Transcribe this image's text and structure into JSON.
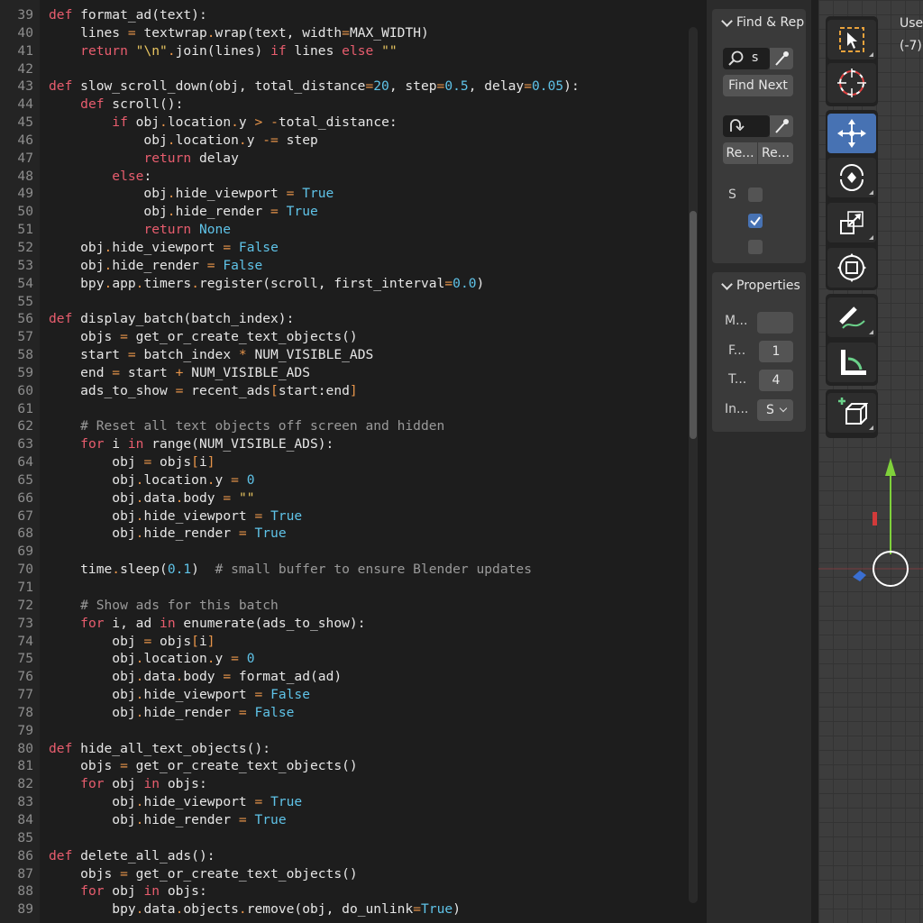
{
  "editor": {
    "first_line": 39,
    "lines": [
      [
        [
          "def",
          "k"
        ],
        [
          " format_ad(text):",
          ""
        ]
      ],
      [
        [
          "    lines ",
          ""
        ],
        [
          "=",
          "o"
        ],
        [
          " textwrap",
          ""
        ],
        [
          ".",
          "o"
        ],
        [
          "wrap(text, width",
          ""
        ],
        [
          "=",
          "o"
        ],
        [
          "MAX_WIDTH)",
          ""
        ]
      ],
      [
        [
          "    ",
          ""
        ],
        [
          "return",
          "k"
        ],
        [
          " ",
          ""
        ],
        [
          "\"\\n\"",
          "s"
        ],
        [
          ".",
          "o"
        ],
        [
          "join(lines) ",
          ""
        ],
        [
          "if",
          "k"
        ],
        [
          " lines ",
          ""
        ],
        [
          "else",
          "k"
        ],
        [
          " ",
          ""
        ],
        [
          "\"\"",
          "s"
        ]
      ],
      [],
      [
        [
          "def",
          "k"
        ],
        [
          " slow_scroll_down(obj, total_distance",
          ""
        ],
        [
          "=",
          "o"
        ],
        [
          "20",
          "n"
        ],
        [
          ", step",
          ""
        ],
        [
          "=",
          "o"
        ],
        [
          "0.5",
          "n"
        ],
        [
          ", delay",
          ""
        ],
        [
          "=",
          "o"
        ],
        [
          "0.05",
          "n"
        ],
        [
          "):",
          ""
        ]
      ],
      [
        [
          "    ",
          ""
        ],
        [
          "def",
          "k"
        ],
        [
          " scroll():",
          ""
        ]
      ],
      [
        [
          "        ",
          ""
        ],
        [
          "if",
          "k"
        ],
        [
          " obj",
          ""
        ],
        [
          ".",
          "o"
        ],
        [
          "location",
          ""
        ],
        [
          ".",
          "o"
        ],
        [
          "y ",
          ""
        ],
        [
          ">",
          "o"
        ],
        [
          " ",
          ""
        ],
        [
          "-",
          "o"
        ],
        [
          "total_distance:",
          ""
        ]
      ],
      [
        [
          "            obj",
          ""
        ],
        [
          ".",
          "o"
        ],
        [
          "location",
          ""
        ],
        [
          ".",
          "o"
        ],
        [
          "y ",
          ""
        ],
        [
          "-=",
          "o"
        ],
        [
          " step",
          ""
        ]
      ],
      [
        [
          "            ",
          ""
        ],
        [
          "return",
          "k"
        ],
        [
          " delay",
          ""
        ]
      ],
      [
        [
          "        ",
          ""
        ],
        [
          "else",
          "k"
        ],
        [
          ":",
          ""
        ]
      ],
      [
        [
          "            obj",
          ""
        ],
        [
          ".",
          "o"
        ],
        [
          "hide_viewport ",
          ""
        ],
        [
          "=",
          "o"
        ],
        [
          " ",
          ""
        ],
        [
          "True",
          "n"
        ]
      ],
      [
        [
          "            obj",
          ""
        ],
        [
          ".",
          "o"
        ],
        [
          "hide_render ",
          ""
        ],
        [
          "=",
          "o"
        ],
        [
          " ",
          ""
        ],
        [
          "True",
          "n"
        ]
      ],
      [
        [
          "            ",
          ""
        ],
        [
          "return",
          "k"
        ],
        [
          " ",
          ""
        ],
        [
          "None",
          "n"
        ]
      ],
      [
        [
          "    obj",
          ""
        ],
        [
          ".",
          "o"
        ],
        [
          "hide_viewport ",
          ""
        ],
        [
          "=",
          "o"
        ],
        [
          " ",
          ""
        ],
        [
          "False",
          "n"
        ]
      ],
      [
        [
          "    obj",
          ""
        ],
        [
          ".",
          "o"
        ],
        [
          "hide_render ",
          ""
        ],
        [
          "=",
          "o"
        ],
        [
          " ",
          ""
        ],
        [
          "False",
          "n"
        ]
      ],
      [
        [
          "    bpy",
          ""
        ],
        [
          ".",
          "o"
        ],
        [
          "app",
          ""
        ],
        [
          ".",
          "o"
        ],
        [
          "timers",
          ""
        ],
        [
          ".",
          "o"
        ],
        [
          "register(scroll, first_interval",
          ""
        ],
        [
          "=",
          "o"
        ],
        [
          "0.0",
          "n"
        ],
        [
          ")",
          ""
        ]
      ],
      [],
      [
        [
          "def",
          "k"
        ],
        [
          " display_batch(batch_index):",
          ""
        ]
      ],
      [
        [
          "    objs ",
          ""
        ],
        [
          "=",
          "o"
        ],
        [
          " get_or_create_text_objects()",
          ""
        ]
      ],
      [
        [
          "    start ",
          ""
        ],
        [
          "=",
          "o"
        ],
        [
          " batch_index ",
          ""
        ],
        [
          "*",
          "o"
        ],
        [
          " NUM_VISIBLE_ADS",
          ""
        ]
      ],
      [
        [
          "    end ",
          ""
        ],
        [
          "=",
          "o"
        ],
        [
          " start ",
          ""
        ],
        [
          "+",
          "o"
        ],
        [
          " NUM_VISIBLE_ADS",
          ""
        ]
      ],
      [
        [
          "    ads_to_show ",
          ""
        ],
        [
          "=",
          "o"
        ],
        [
          " recent_ads",
          ""
        ],
        [
          "[",
          "o"
        ],
        [
          "start:end",
          ""
        ],
        [
          "]",
          "o"
        ]
      ],
      [],
      [
        [
          "    ",
          ""
        ],
        [
          "# Reset all text objects off screen and hidden",
          "c"
        ]
      ],
      [
        [
          "    ",
          ""
        ],
        [
          "for",
          "k"
        ],
        [
          " i ",
          ""
        ],
        [
          "in",
          "k"
        ],
        [
          " range(NUM_VISIBLE_ADS):",
          ""
        ]
      ],
      [
        [
          "        obj ",
          ""
        ],
        [
          "=",
          "o"
        ],
        [
          " objs",
          ""
        ],
        [
          "[",
          "o"
        ],
        [
          "i",
          ""
        ],
        [
          "]",
          "o"
        ]
      ],
      [
        [
          "        obj",
          ""
        ],
        [
          ".",
          "o"
        ],
        [
          "location",
          ""
        ],
        [
          ".",
          "o"
        ],
        [
          "y ",
          ""
        ],
        [
          "=",
          "o"
        ],
        [
          " ",
          ""
        ],
        [
          "0",
          "n"
        ]
      ],
      [
        [
          "        obj",
          ""
        ],
        [
          ".",
          "o"
        ],
        [
          "data",
          ""
        ],
        [
          ".",
          "o"
        ],
        [
          "body ",
          ""
        ],
        [
          "=",
          "o"
        ],
        [
          " ",
          ""
        ],
        [
          "\"\"",
          "s"
        ]
      ],
      [
        [
          "        obj",
          ""
        ],
        [
          ".",
          "o"
        ],
        [
          "hide_viewport ",
          ""
        ],
        [
          "=",
          "o"
        ],
        [
          " ",
          ""
        ],
        [
          "True",
          "n"
        ]
      ],
      [
        [
          "        obj",
          ""
        ],
        [
          ".",
          "o"
        ],
        [
          "hide_render ",
          ""
        ],
        [
          "=",
          "o"
        ],
        [
          " ",
          ""
        ],
        [
          "True",
          "n"
        ]
      ],
      [],
      [
        [
          "    time",
          ""
        ],
        [
          ".",
          "o"
        ],
        [
          "sleep(",
          ""
        ],
        [
          "0.1",
          "n"
        ],
        [
          ")  ",
          ""
        ],
        [
          "# small buffer to ensure Blender updates",
          "c"
        ]
      ],
      [],
      [
        [
          "    ",
          ""
        ],
        [
          "# Show ads for this batch",
          "c"
        ]
      ],
      [
        [
          "    ",
          ""
        ],
        [
          "for",
          "k"
        ],
        [
          " i, ad ",
          ""
        ],
        [
          "in",
          "k"
        ],
        [
          " enumerate(ads_to_show):",
          ""
        ]
      ],
      [
        [
          "        obj ",
          ""
        ],
        [
          "=",
          "o"
        ],
        [
          " objs",
          ""
        ],
        [
          "[",
          "o"
        ],
        [
          "i",
          ""
        ],
        [
          "]",
          "o"
        ]
      ],
      [
        [
          "        obj",
          ""
        ],
        [
          ".",
          "o"
        ],
        [
          "location",
          ""
        ],
        [
          ".",
          "o"
        ],
        [
          "y ",
          ""
        ],
        [
          "=",
          "o"
        ],
        [
          " ",
          ""
        ],
        [
          "0",
          "n"
        ]
      ],
      [
        [
          "        obj",
          ""
        ],
        [
          ".",
          "o"
        ],
        [
          "data",
          ""
        ],
        [
          ".",
          "o"
        ],
        [
          "body ",
          ""
        ],
        [
          "=",
          "o"
        ],
        [
          " format_ad(ad)",
          ""
        ]
      ],
      [
        [
          "        obj",
          ""
        ],
        [
          ".",
          "o"
        ],
        [
          "hide_viewport ",
          ""
        ],
        [
          "=",
          "o"
        ],
        [
          " ",
          ""
        ],
        [
          "False",
          "n"
        ]
      ],
      [
        [
          "        obj",
          ""
        ],
        [
          ".",
          "o"
        ],
        [
          "hide_render ",
          ""
        ],
        [
          "=",
          "o"
        ],
        [
          " ",
          ""
        ],
        [
          "False",
          "n"
        ]
      ],
      [],
      [
        [
          "def",
          "k"
        ],
        [
          " hide_all_text_objects():",
          ""
        ]
      ],
      [
        [
          "    objs ",
          ""
        ],
        [
          "=",
          "o"
        ],
        [
          " get_or_create_text_objects()",
          ""
        ]
      ],
      [
        [
          "    ",
          ""
        ],
        [
          "for",
          "k"
        ],
        [
          " obj ",
          ""
        ],
        [
          "in",
          "k"
        ],
        [
          " objs:",
          ""
        ]
      ],
      [
        [
          "        obj",
          ""
        ],
        [
          ".",
          "o"
        ],
        [
          "hide_viewport ",
          ""
        ],
        [
          "=",
          "o"
        ],
        [
          " ",
          ""
        ],
        [
          "True",
          "n"
        ]
      ],
      [
        [
          "        obj",
          ""
        ],
        [
          ".",
          "o"
        ],
        [
          "hide_render ",
          ""
        ],
        [
          "=",
          "o"
        ],
        [
          " ",
          ""
        ],
        [
          "True",
          "n"
        ]
      ],
      [],
      [
        [
          "def",
          "k"
        ],
        [
          " delete_all_ads():",
          ""
        ]
      ],
      [
        [
          "    objs ",
          ""
        ],
        [
          "=",
          "o"
        ],
        [
          " get_or_create_text_objects()",
          ""
        ]
      ],
      [
        [
          "    ",
          ""
        ],
        [
          "for",
          "k"
        ],
        [
          " obj ",
          ""
        ],
        [
          "in",
          "k"
        ],
        [
          " objs:",
          ""
        ]
      ],
      [
        [
          "        bpy",
          ""
        ],
        [
          ".",
          "o"
        ],
        [
          "data",
          ""
        ],
        [
          ".",
          "o"
        ],
        [
          "objects",
          ""
        ],
        [
          ".",
          "o"
        ],
        [
          "remove(obj, do_unlink",
          ""
        ],
        [
          "=",
          "o"
        ],
        [
          "True",
          "n"
        ],
        [
          ")",
          ""
        ]
      ]
    ],
    "scroll_position": 0.21,
    "scroll_visible_fraction": 0.26
  },
  "sidebar": {
    "find_panel": {
      "title": "Find & Rep",
      "search_value": "s",
      "find_next_label": "Find Next",
      "replace_label": "Re...",
      "replace_all_label": "Re...",
      "option_label": "S",
      "options": [
        false,
        true,
        false
      ]
    },
    "properties_panel": {
      "title": "Properties",
      "margin_label": "M...",
      "font_label": "F...",
      "font_value": "1",
      "tab_label": "T...",
      "tab_value": "4",
      "indent_label": "In...",
      "indent_value": "S"
    }
  },
  "viewport": {
    "label": "Use",
    "coord": "(-7)",
    "tools": [
      "select-box-icon",
      "cursor-icon",
      "move-icon",
      "rotate-icon",
      "scale-icon",
      "transform-icon",
      "annotate-icon",
      "measure-icon",
      "add-cube-icon"
    ],
    "active_tool": "move-icon"
  },
  "colors": {
    "accent": "#4772b3",
    "keyword": "#e85d6e",
    "number": "#5fc3e8",
    "string": "#e8c560",
    "operator": "#e8954a",
    "comment": "#9a9a9a"
  }
}
